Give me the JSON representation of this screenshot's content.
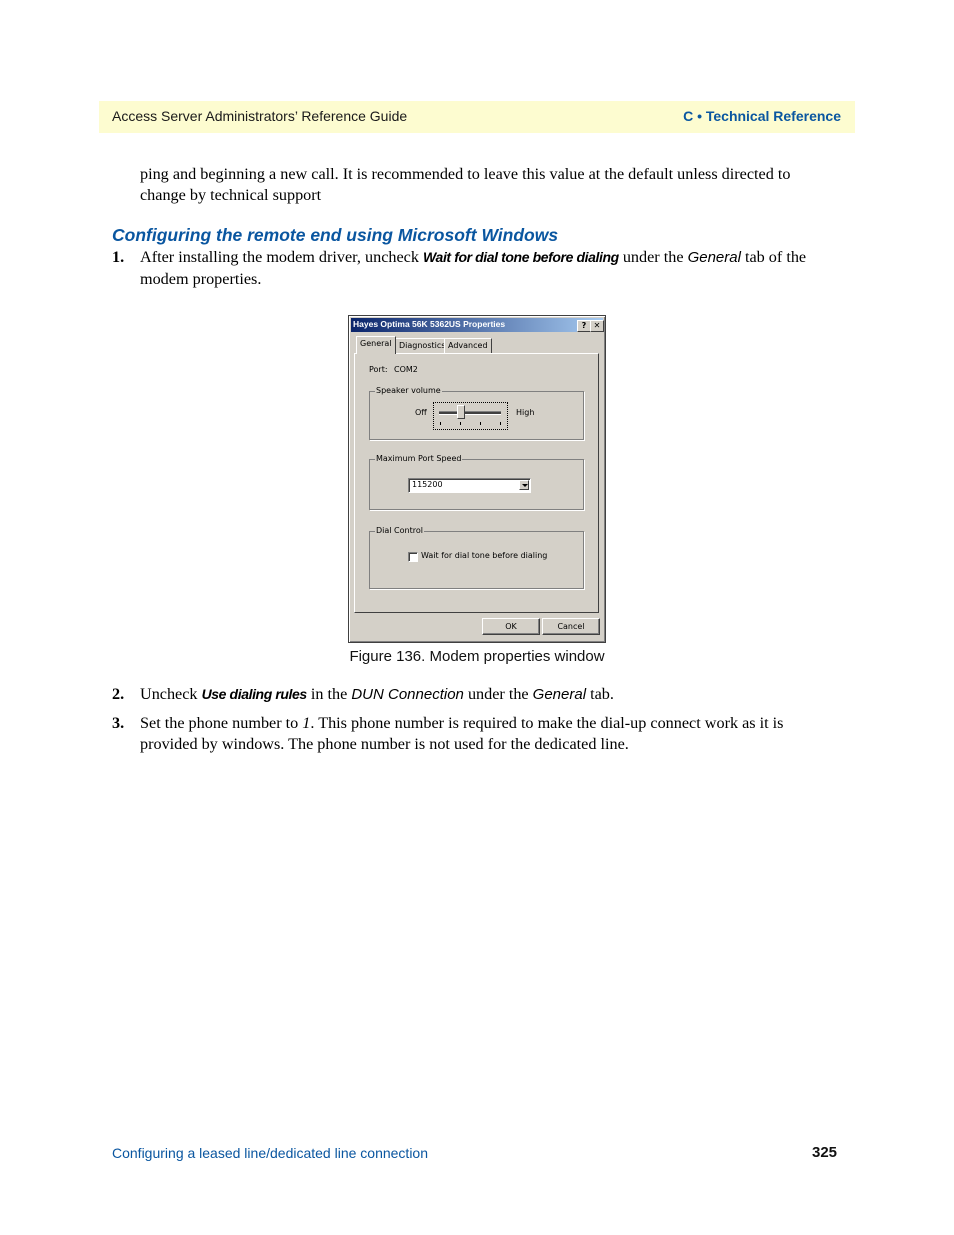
{
  "header": {
    "left": "Access Server Administrators’ Reference Guide",
    "right": "C • Technical Reference"
  },
  "intro_paragraph": "ping and beginning a new call. It is recommended to leave this value at the default unless directed to change by technical support",
  "section_heading": "Configuring the remote end using Microsoft Windows",
  "steps": [
    {
      "number": "1.",
      "parts": [
        "After installing the modem driver, uncheck ",
        "Wait for dial tone before dialing",
        " under the ",
        "General",
        " tab of the modem properties."
      ]
    },
    {
      "number": "2.",
      "parts": [
        "Uncheck ",
        "Use dialing rules",
        " in the ",
        "DUN Connection",
        " under the ",
        "General",
        " tab."
      ]
    },
    {
      "number": "3.",
      "parts": [
        "Set the phone number to ",
        "1",
        ". This phone number is required to make the dial-up connect work as it is provided by windows. The phone number is not used for the dedicated line."
      ]
    }
  ],
  "figure": {
    "caption": "Figure 136. Modem properties window",
    "dialog": {
      "title": "Hayes Optima 56K 5362US Properties",
      "help_button": "?",
      "close_button": "✕",
      "tabs": [
        "General",
        "Diagnostics",
        "Advanced"
      ],
      "active_tab": "General",
      "port_label": "Port:",
      "port_value": "COM2",
      "speaker_group": "Speaker volume",
      "speaker_min": "Off",
      "speaker_max": "High",
      "speaker_level": {
        "value": 1,
        "min": 0,
        "max": 3
      },
      "port_speed_group": "Maximum Port Speed",
      "port_speed_value": "115200",
      "dial_group": "Dial Control",
      "dial_checkbox_label": "Wait for dial tone before dialing",
      "dial_checkbox_checked": false,
      "ok_label": "OK",
      "cancel_label": "Cancel"
    }
  },
  "footer": {
    "left": "Configuring a leased line/dedicated line connection",
    "page_number": "325"
  }
}
